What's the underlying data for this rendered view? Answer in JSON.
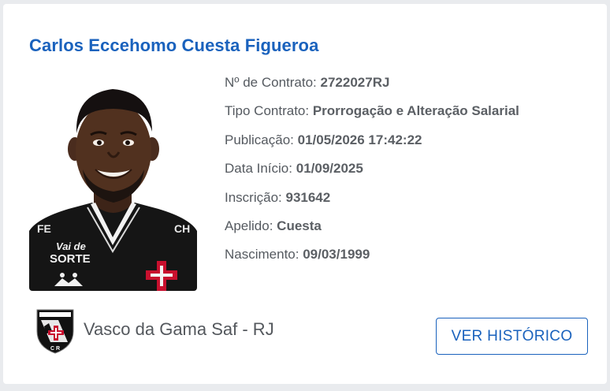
{
  "player": {
    "name": "Carlos Eccehomo Cuesta Figueroa",
    "photo_alt": "Foto do jogador"
  },
  "details": [
    {
      "label": "Nº de Contrato:",
      "value": "2722027RJ"
    },
    {
      "label": "Tipo Contrato:",
      "value": "Prorrogação e Alteração Salarial"
    },
    {
      "label": "Publicação:",
      "value": "01/05/2026 17:42:22"
    },
    {
      "label": "Data Início:",
      "value": "01/09/2025"
    },
    {
      "label": "Inscrição:",
      "value": "931642"
    },
    {
      "label": "Apelido:",
      "value": "Cuesta"
    },
    {
      "label": "Nascimento:",
      "value": "09/03/1999"
    }
  ],
  "club": {
    "name": "Vasco da Gama Saf - RJ",
    "crest_icon": "vasco-crest-icon"
  },
  "actions": {
    "history_label": "VER HISTÓRICO"
  },
  "colors": {
    "accent": "#1a62bd",
    "text": "#555a60",
    "background": "#e9ebee",
    "card": "#ffffff"
  }
}
